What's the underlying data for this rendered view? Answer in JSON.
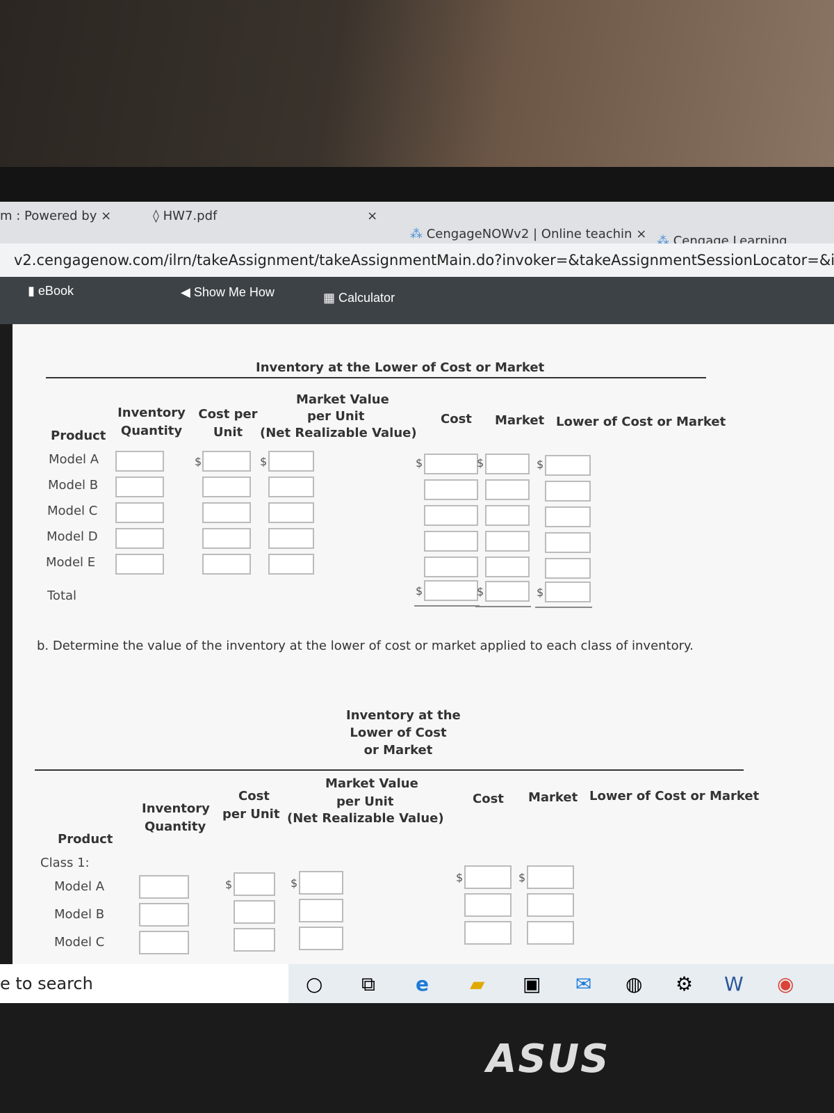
{
  "browser": {
    "tabs": [
      {
        "label": "m : Powered by",
        "close": "×"
      },
      {
        "label": "HW7.pdf",
        "close": "×"
      },
      {
        "label": "CengageNOWv2 | Online teachin",
        "close": "×"
      },
      {
        "label": "Cengage Learning"
      }
    ],
    "url": "v2.cengagenow.com/ilrn/takeAssignment/takeAssignmentMain.do?invoker=&takeAssignmentSessionLocator=&inprogress=f"
  },
  "toolbar": {
    "ebook": "eBook",
    "show_me_how": "Show Me How",
    "calculator": "Calculator"
  },
  "part_a": {
    "title": "Inventory at the Lower of Cost or Market",
    "headers": {
      "product": "Product",
      "inv_qty": "Inventory Quantity",
      "cost_unit": "Cost per Unit",
      "market_line1": "Market Value",
      "market_line2": "per Unit",
      "market_line3": "(Net Realizable Value)",
      "cost": "Cost",
      "market": "Market",
      "lcm": "Lower of Cost or Market"
    },
    "rows": [
      "Model A",
      "Model B",
      "Model C",
      "Model D",
      "Model E"
    ],
    "total": "Total",
    "currency": "$"
  },
  "part_b": {
    "instruction": "b. Determine the value of the inventory at the lower of cost or market applied to each class of inventory.",
    "title_lines": [
      "Inventory at the",
      "Lower of Cost",
      "or Market"
    ],
    "headers": {
      "product": "Product",
      "inv_qty_1": "Inventory",
      "inv_qty_2": "Quantity",
      "cost_1": "Cost",
      "cost_2": "per Unit",
      "market_1": "Market Value",
      "market_2": "per Unit",
      "market_3": "(Net Realizable Value)",
      "cost": "Cost",
      "market": "Market",
      "lcm": "Lower of Cost or Market"
    },
    "class_label": "Class 1:",
    "rows": [
      "Model A",
      "Model B",
      "Model C"
    ],
    "currency": "$"
  },
  "taskbar": {
    "search": "e to search"
  },
  "brand": "ASUS"
}
